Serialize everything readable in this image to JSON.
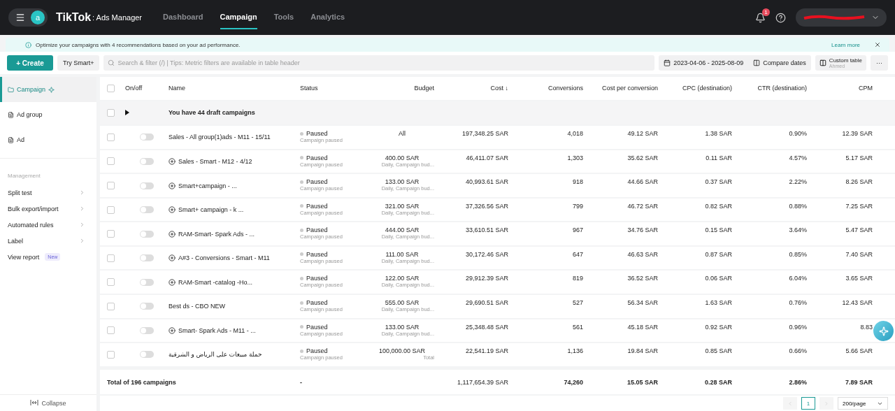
{
  "topbar": {
    "avatar": "a",
    "brand": "TikTok",
    "product": ": Ads Manager",
    "nav": [
      {
        "label": "Dashboard",
        "selected": false
      },
      {
        "label": "Campaign",
        "selected": true
      },
      {
        "label": "Tools",
        "selected": false
      },
      {
        "label": "Analytics",
        "selected": false
      }
    ],
    "notifications": "1"
  },
  "banner": {
    "text": "Optimize your campaigns with 4 recommendations based on your ad performance.",
    "link": "Learn more"
  },
  "toolbar": {
    "create": "+ Create",
    "try_smart": "Try Smart+",
    "search": {
      "placeholder": "Search & filter (/) | Tips: Metric filters are available in table header"
    },
    "date_range": "2023-04-06 - 2025-08-09",
    "compare": "Compare dates",
    "custom_table": "Custom table",
    "custom_table_sub": "Ahmed",
    "more": "···"
  },
  "sidebar": {
    "levels": [
      {
        "label": "Campaign",
        "selected": true
      },
      {
        "label": "Ad group",
        "selected": false
      },
      {
        "label": "Ad",
        "selected": false
      }
    ],
    "management_title": "Management",
    "items": [
      {
        "label": "Split test"
      },
      {
        "label": "Bulk export/import"
      },
      {
        "label": "Automated rules"
      },
      {
        "label": "Label"
      }
    ],
    "view_report": "View report",
    "new_badge": "New",
    "collapse": "Collapse"
  },
  "table": {
    "columns": [
      "On/off",
      "Name",
      "Status",
      "Budget",
      "Cost ↓",
      "Conversions",
      "Cost per conversion",
      "CPC (destination)",
      "CTR (destination)",
      "CPM"
    ],
    "all_checked": false,
    "draft_checked": false,
    "draft_expanded": false,
    "draft": "You have 44 draft campaigns",
    "rows": [
      {
        "checked": false,
        "on": false,
        "kind": "standard",
        "name": "Sales - All group(1)ads - M11 - 15/11",
        "status": "Paused",
        "status_sub": "Campaign paused",
        "budget": "All",
        "cost": "197,348.25 SAR",
        "conversions": "4,018",
        "cpa": "49.12 SAR",
        "cpc": "1.38 SAR",
        "ctr": "0.90%",
        "cpm": "12.39 SAR"
      },
      {
        "checked": false,
        "on": false,
        "kind": "smart",
        "name": "Sales - Smart - M12 - 4/12",
        "status": "Paused",
        "status_sub": "Campaign paused",
        "budget": "400.00 SAR",
        "budget_sub": "Daily, Campaign bud...",
        "cost": "46,411.07 SAR",
        "conversions": "1,303",
        "cpa": "35.62 SAR",
        "cpc": "0.11 SAR",
        "ctr": "4.57%",
        "cpm": "5.17 SAR"
      },
      {
        "checked": false,
        "on": false,
        "kind": "smart",
        "name": "Smart+campaign - ...",
        "status": "Paused",
        "status_sub": "Campaign paused",
        "budget": "133.00 SAR",
        "budget_sub": "Daily, Campaign bud...",
        "cost": "40,993.61 SAR",
        "conversions": "918",
        "cpa": "44.66 SAR",
        "cpc": "0.37 SAR",
        "ctr": "2.22%",
        "cpm": "8.26 SAR"
      },
      {
        "checked": false,
        "on": false,
        "kind": "smart",
        "name": "Smart+ campaign - k ...",
        "status": "Paused",
        "status_sub": "Campaign paused",
        "budget": "321.00 SAR",
        "budget_sub": "Daily, Campaign bud...",
        "cost": "37,326.56 SAR",
        "conversions": "799",
        "cpa": "46.72 SAR",
        "cpc": "0.82 SAR",
        "ctr": "0.88%",
        "cpm": "7.25 SAR"
      },
      {
        "checked": false,
        "on": false,
        "kind": "smart",
        "name": "RAM-Smart- Spark Ads - ...",
        "status": "Paused",
        "status_sub": "Campaign paused",
        "budget": "444.00 SAR",
        "budget_sub": "Daily, Campaign bud...",
        "cost": "33,610.51 SAR",
        "conversions": "967",
        "cpa": "34.76 SAR",
        "cpc": "0.15 SAR",
        "ctr": "3.64%",
        "cpm": "5.47 SAR"
      },
      {
        "checked": false,
        "on": false,
        "kind": "smart",
        "name": "A#3 - Conversions - Smart - M11",
        "status": "Paused",
        "status_sub": "Campaign paused",
        "budget": "111.00 SAR",
        "budget_sub": "Daily, Campaign bud...",
        "cost": "30,172.46 SAR",
        "conversions": "647",
        "cpa": "46.63 SAR",
        "cpc": "0.87 SAR",
        "ctr": "0.85%",
        "cpm": "7.40 SAR"
      },
      {
        "checked": false,
        "on": false,
        "kind": "smart",
        "name": "RAM-Smart -catalog -Ho...",
        "status": "Paused",
        "status_sub": "Campaign paused",
        "budget": "122.00 SAR",
        "budget_sub": "Daily, Campaign bud...",
        "cost": "29,912.39 SAR",
        "conversions": "819",
        "cpa": "36.52 SAR",
        "cpc": "0.06 SAR",
        "ctr": "6.04%",
        "cpm": "3.65 SAR"
      },
      {
        "checked": false,
        "on": false,
        "kind": "standard",
        "name": "Best ds - CBO NEW",
        "status": "Paused",
        "status_sub": "Campaign paused",
        "budget": "555.00 SAR",
        "budget_sub": "Daily, Campaign bud...",
        "cost": "29,690.51 SAR",
        "conversions": "527",
        "cpa": "56.34 SAR",
        "cpc": "1.63 SAR",
        "ctr": "0.76%",
        "cpm": "12.43 SAR"
      },
      {
        "checked": false,
        "on": false,
        "kind": "smart",
        "name": "Smart- Spark Ads - M11 - ...",
        "status": "Paused",
        "status_sub": "Campaign paused",
        "budget": "133.00 SAR",
        "budget_sub": "Daily, Campaign bud...",
        "cost": "25,348.48 SAR",
        "conversions": "561",
        "cpa": "45.18 SAR",
        "cpc": "0.92 SAR",
        "ctr": "0.96%",
        "cpm": "8.83"
      },
      {
        "checked": false,
        "on": false,
        "kind": "standard",
        "name": "حملة مبيعات على الرياض و الشرقية",
        "status": "Paused",
        "status_sub": "Campaign paused",
        "budget": "100,000.00 SAR",
        "budget_sub": "Total",
        "cost": "22,541.19 SAR",
        "conversions": "1,136",
        "cpa": "19.84 SAR",
        "cpc": "0.85 SAR",
        "ctr": "0.66%",
        "cpm": "5.66 SAR"
      }
    ],
    "total": {
      "label": "Total of 196 campaigns",
      "budget": "-",
      "cost": "1,117,654.39 SAR",
      "conversions": "74,260",
      "cpa": "15.05 SAR",
      "cpc": "0.28 SAR",
      "ctr": "2.86%",
      "cpm": "7.89 SAR"
    }
  },
  "pagination": {
    "pages": [
      {
        "label": "1",
        "selected": true
      }
    ],
    "page_size": "200/page"
  }
}
